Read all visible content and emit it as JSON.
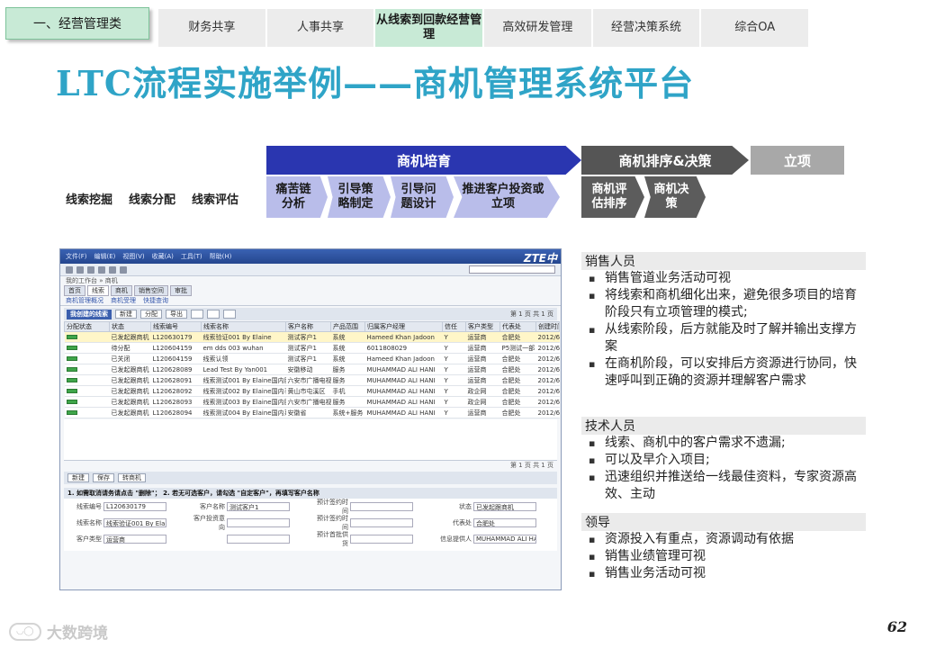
{
  "category_tab": "一、经营管理类",
  "nav_tabs": [
    {
      "label": "财务共享"
    },
    {
      "label": "人事共享"
    },
    {
      "label": "从线索到回款经营管理",
      "active": true
    },
    {
      "label": "高效研发管理"
    },
    {
      "label": "经营决策系统"
    },
    {
      "label": "综合OA"
    }
  ],
  "title": "LTC流程实施举例——商机管理系统平台",
  "flow": {
    "phase1": "商机培育",
    "phase2": "商机排序&决策",
    "phase3": "立项",
    "plain_steps": [
      "线索挖掘",
      "线索分配",
      "线索评估"
    ],
    "light_steps": [
      "痛苦链分析",
      "引导策略制定",
      "引导问题设计",
      "推进客户投资或立项"
    ],
    "dark_steps": [
      "商机评估排序",
      "商机决策"
    ]
  },
  "screenshot": {
    "menu": [
      "文件(F)",
      "编辑(E)",
      "视图(V)",
      "收藏(A)",
      "工具(T)",
      "帮助(H)"
    ],
    "logo": "ZTE中",
    "crumb": "我的工作台 » 商机",
    "tabs": [
      "首页",
      "线索",
      "商机",
      "销售空间",
      "审批"
    ],
    "sub_links": [
      "商机管理概况",
      "商机受理",
      "快捷查询"
    ],
    "list_label": "我创建的线索",
    "list_buttons": [
      "新建",
      "分配",
      "导出"
    ],
    "page_info": "第 1 页 共 1 页",
    "columns": [
      "分配状态",
      "状态",
      "线索编号",
      "线索名称",
      "客户名称",
      "产品范围",
      "归属客户经理",
      "信任",
      "客户类型",
      "代表处",
      "创建时间"
    ],
    "rows": [
      [
        "",
        "已发起跟商机",
        "L120630179",
        "线索验证001 By Elaine",
        "测试客户1",
        "系统",
        "Hameed Khan Jadoon",
        "Y",
        "运营商",
        "合肥处",
        "2012/6"
      ],
      [
        "",
        "待分配",
        "L120604159",
        "em dds 003 wuhan",
        "测试客户1",
        "系统",
        "6011808029",
        "Y",
        "运营商",
        "P5测试一部",
        "2012/6"
      ],
      [
        "",
        "已关闭",
        "L120604159",
        "线索认领",
        "测试客户1",
        "系统",
        "Hameed Khan Jadoon",
        "Y",
        "运营商",
        "合肥处",
        "2012/6"
      ],
      [
        "",
        "已发起跟商机",
        "L120628089",
        "Lead Test By Yan001",
        "安徽移动",
        "服务",
        "MUHAMMAD ALI HANI",
        "Y",
        "运营商",
        "合肥处",
        "2012/6"
      ],
      [
        "",
        "已发起跟商机",
        "L120628091",
        "线索测试001 By Elaine国内服务",
        "六安市广播电视",
        "服务",
        "MUHAMMAD ALI HANI",
        "Y",
        "运营商",
        "合肥处",
        "2012/6"
      ],
      [
        "",
        "已发起跟商机",
        "L120628092",
        "线索测试002 By Elaine国内手机",
        "黄山市屯溪区",
        "手机",
        "MUHAMMAD ALI HANI",
        "Y",
        "政企网",
        "合肥处",
        "2012/6"
      ],
      [
        "",
        "已发起跟商机",
        "L120628093",
        "线索测试003 By Elaine国内服务",
        "六安市广播电视",
        "服务",
        "MUHAMMAD ALI HANI",
        "Y",
        "政企网",
        "合肥处",
        "2012/6"
      ],
      [
        "",
        "已发起跟商机",
        "L120628094",
        "线索测试004 By Elaine国内系统+服务",
        "安徽省",
        "系统+服务",
        "MUHAMMAD ALI HANI",
        "Y",
        "运营商",
        "合肥处",
        "2012/6"
      ]
    ],
    "grid_footer": "第 1 页 共 1 页",
    "detail_buttons": [
      "新建",
      "保存",
      "转商机"
    ],
    "detail_note": "1. 如需取消请务请点击 \"删除\"；  2. 若无可选客户，请勾选 \"自定客户\"，再填写客户名称",
    "form": [
      {
        "k": "线索编号",
        "v": "L120630179"
      },
      {
        "k": "客户名称",
        "v": "测试客户1"
      },
      {
        "k": "预计签约时间",
        "v": ""
      },
      {
        "k": "状态",
        "v": "已发起跟商机"
      },
      {
        "k": "线索名称",
        "v": "线索验证001 By Elaine"
      },
      {
        "k": "客户投资意向",
        "v": ""
      },
      {
        "k": "预计签约时间",
        "v": ""
      },
      {
        "k": "代表处",
        "v": "合肥处"
      },
      {
        "k": "客户类型",
        "v": "运营商"
      },
      {
        "k": "",
        "v": ""
      },
      {
        "k": "预计首批供货",
        "v": ""
      },
      {
        "k": "信息提供人",
        "v": "MUHAMMAD ALI HANI"
      }
    ]
  },
  "panels": [
    {
      "head": "销售人员",
      "items": [
        "销售管道业务活动可视",
        "将线索和商机细化出来，避免很多项目的培育阶段只有立项管理的模式;",
        "从线索阶段，后方就能及时了解并输出支撑方案",
        "在商机阶段，可以安排后方资源进行协同，快速呼叫到正确的资源并理解客户需求"
      ]
    },
    {
      "head": "技术人员",
      "items": [
        "线索、商机中的客户需求不遗漏;",
        "可以及早介入项目;",
        "迅速组织并推送给一线最佳资料，专家资源高效、主动"
      ]
    },
    {
      "head": "领导",
      "items": [
        "资源投入有重点，资源调动有依据",
        "销售业绩管理可视",
        "销售业务活动可视"
      ]
    }
  ],
  "page_number": "62",
  "watermark": "大数跨境"
}
